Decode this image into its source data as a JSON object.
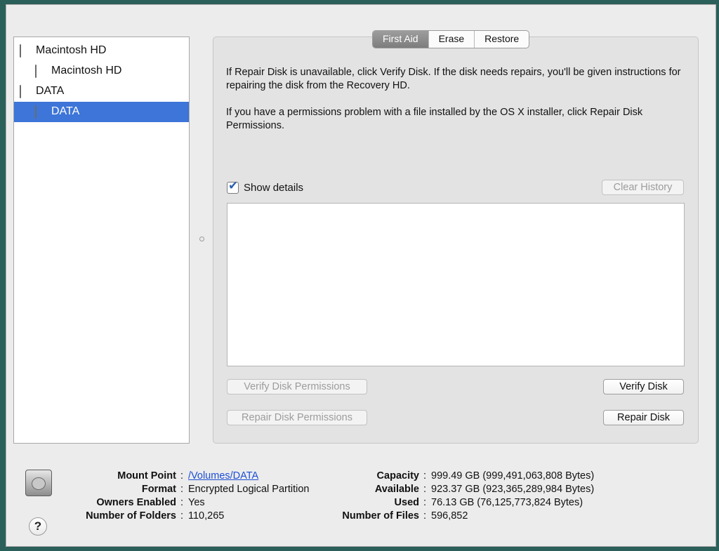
{
  "sidebar": {
    "items": [
      {
        "label": "Macintosh HD",
        "level": 0,
        "selected": false,
        "icon": "hard-disk-icon"
      },
      {
        "label": "Macintosh HD",
        "level": 1,
        "selected": false,
        "icon": "volume-icon"
      },
      {
        "label": "DATA",
        "level": 0,
        "selected": false,
        "icon": "hard-disk-icon"
      },
      {
        "label": "DATA",
        "level": 1,
        "selected": true,
        "icon": "volume-icon"
      }
    ]
  },
  "tabs": [
    {
      "label": "First Aid",
      "active": true
    },
    {
      "label": "Erase",
      "active": false
    },
    {
      "label": "Restore",
      "active": false
    }
  ],
  "first_aid": {
    "info_1": "If Repair Disk is unavailable, click Verify Disk. If the disk needs repairs, you'll be given instructions for repairing the disk from the Recovery HD.",
    "info_2": "If you have a permissions problem with a file installed by the OS X installer, click Repair Disk Permissions.",
    "show_details_label": "Show details",
    "show_details_checked": true,
    "clear_history_label": "Clear History",
    "verify_permissions_label": "Verify Disk Permissions",
    "repair_permissions_label": "Repair Disk Permissions",
    "verify_disk_label": "Verify Disk",
    "repair_disk_label": "Repair Disk"
  },
  "info": {
    "mount_point_label": "Mount Point",
    "mount_point": "/Volumes/DATA",
    "format_label": "Format",
    "format": "Encrypted Logical Partition",
    "owners_enabled_label": "Owners Enabled",
    "owners_enabled": "Yes",
    "folders_label": "Number of Folders",
    "folders": "110,265",
    "capacity_label": "Capacity",
    "capacity": "999.49 GB (999,491,063,808 Bytes)",
    "available_label": "Available",
    "available": "923.37 GB (923,365,289,984 Bytes)",
    "used_label": "Used",
    "used": "76.13 GB (76,125,773,824 Bytes)",
    "files_label": "Number of Files",
    "files": "596,852",
    "separator": ":"
  },
  "help_label": "?",
  "colors": {
    "selection": "#3d75d8",
    "link": "#1d4fd6",
    "window_bg": "#ececec"
  }
}
